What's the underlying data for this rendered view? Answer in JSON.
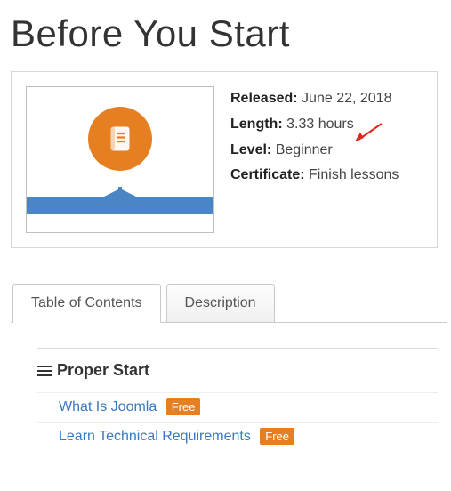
{
  "title": "Before You Start",
  "meta": {
    "released_label": "Released:",
    "released_value": "June 22, 2018",
    "length_label": "Length:",
    "length_value": "3.33 hours",
    "level_label": "Level:",
    "level_value": "Beginner",
    "cert_label": "Certificate:",
    "cert_value": "Finish lessons"
  },
  "tabs": {
    "toc": "Table of Contents",
    "desc": "Description"
  },
  "section": {
    "title": "Proper Start",
    "lessons": [
      {
        "title": "What Is Joomla",
        "badge": "Free"
      },
      {
        "title": "Learn Technical Requirements",
        "badge": "Free"
      }
    ]
  }
}
